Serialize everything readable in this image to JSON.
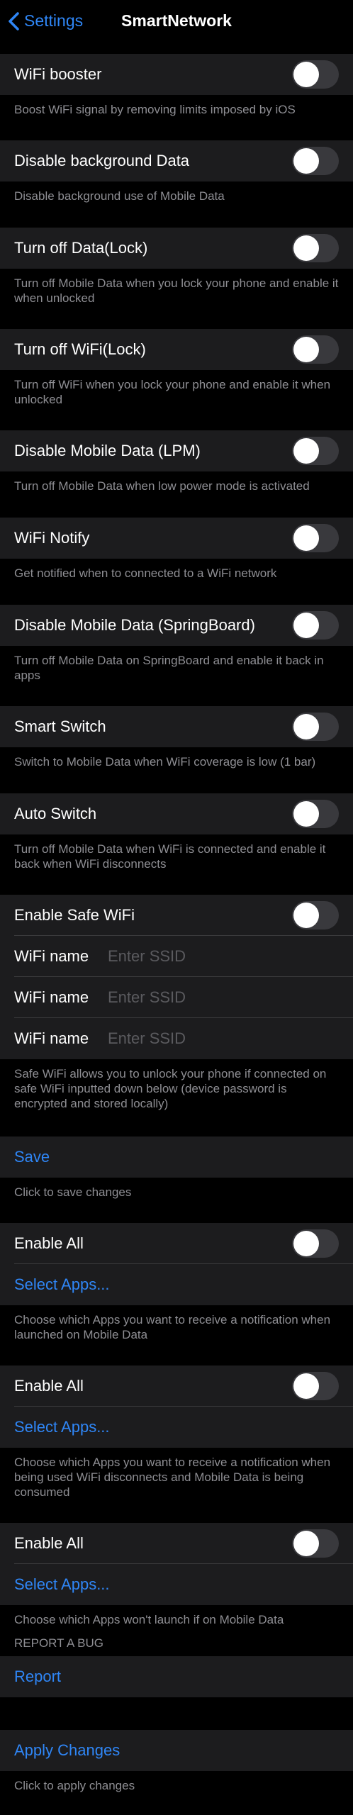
{
  "nav": {
    "back_label": "Settings",
    "title": "SmartNetwork"
  },
  "colors": {
    "accent": "#2f86f6",
    "cell": "#1c1c1e",
    "footer_text": "#8e8e93"
  },
  "sections": {
    "wifi_booster": {
      "label": "WiFi booster",
      "footer": "Boost WiFi signal by removing limits imposed by iOS",
      "enabled": false
    },
    "disable_bg_data": {
      "label": "Disable background Data",
      "footer": "Disable background use of Mobile Data",
      "enabled": false
    },
    "turn_off_data_lock": {
      "label": "Turn off Data(Lock)",
      "footer": "Turn off Mobile Data when you lock your phone and enable it when unlocked",
      "enabled": false
    },
    "turn_off_wifi_lock": {
      "label": "Turn off WiFi(Lock)",
      "footer": "Turn off WiFi when you lock your phone and enable it when unlocked",
      "enabled": false
    },
    "disable_data_lpm": {
      "label": "Disable Mobile Data (LPM)",
      "footer": "Turn off Mobile Data when low power mode is activated",
      "enabled": false
    },
    "wifi_notify": {
      "label": "WiFi Notify",
      "footer": "Get notified when to connected to a WiFi network",
      "enabled": false
    },
    "disable_data_springboard": {
      "label": "Disable Mobile Data (SpringBoard)",
      "footer": "Turn off Mobile Data on SpringBoard and enable it back in apps",
      "enabled": false
    },
    "smart_switch": {
      "label": "Smart Switch",
      "footer": "Switch to Mobile Data when WiFi coverage is low (1 bar)",
      "enabled": false
    },
    "auto_switch": {
      "label": "Auto Switch",
      "footer": "Turn off Mobile Data when WiFi is connected and enable it back when WiFi disconnects",
      "enabled": false
    },
    "safe_wifi": {
      "label": "Enable Safe WiFi",
      "enabled": false,
      "fields": [
        {
          "label": "WiFi name",
          "value": "",
          "placeholder": "Enter SSID"
        },
        {
          "label": "WiFi name",
          "value": "",
          "placeholder": "Enter SSID"
        },
        {
          "label": "WiFi name",
          "value": "",
          "placeholder": "Enter SSID"
        }
      ],
      "footer": "Safe WiFi allows you to unlock your phone if connected on safe WiFi inputted down below (device password is encrypted and stored locally)"
    },
    "save": {
      "label": "Save",
      "footer": "Click to save changes"
    },
    "apps_launch": {
      "toggle_label": "Enable All",
      "select_label": "Select Apps...",
      "footer": "Choose which Apps you want to receive a notification when launched on Mobile Data",
      "enabled": false
    },
    "apps_consume": {
      "toggle_label": "Enable All",
      "select_label": "Select Apps...",
      "footer": "Choose which Apps you want to receive a notification when being used WiFi disconnects and Mobile Data is being consumed",
      "enabled": false
    },
    "apps_block": {
      "toggle_label": "Enable All",
      "select_label": "Select Apps...",
      "footer": "Choose which Apps won't launch if on Mobile Data",
      "enabled": false
    },
    "report": {
      "header": "REPORT A BUG",
      "label": "Report"
    },
    "apply": {
      "label": "Apply Changes",
      "footer": "Click to apply changes"
    }
  }
}
